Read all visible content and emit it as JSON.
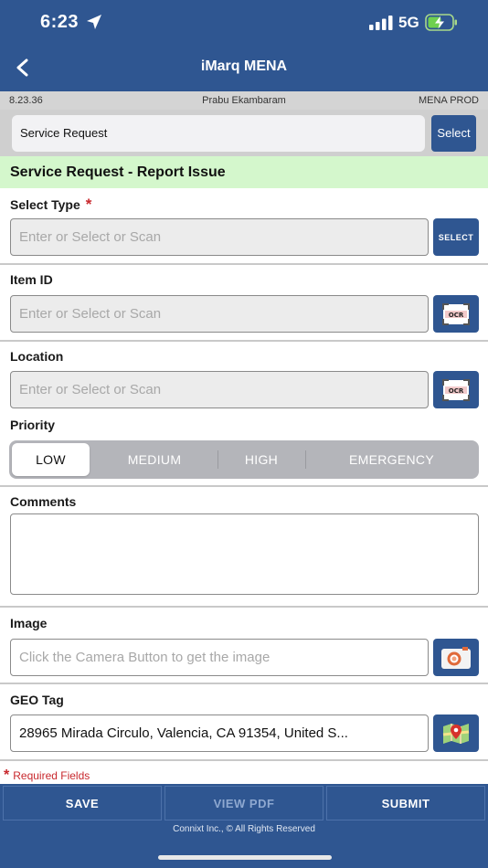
{
  "status": {
    "time": "6:23",
    "network": "5G"
  },
  "header": {
    "title": "iMarq MENA"
  },
  "infobar": {
    "version": "8.23.36",
    "user": "Prabu Ekambaram",
    "environment": "MENA PROD"
  },
  "search": {
    "value": "Service Request",
    "select_label": "Select"
  },
  "section": {
    "title": "Service Request - Report Issue"
  },
  "form": {
    "select_type": {
      "label": "Select Type",
      "required": "*",
      "placeholder": "Enter or Select or Scan",
      "button": "SELECT"
    },
    "item_id": {
      "label": "Item ID",
      "placeholder": "Enter or Select or Scan",
      "button_icon": "ocr-scan-icon"
    },
    "location": {
      "label": "Location",
      "placeholder": "Enter or Select or Scan",
      "button_icon": "ocr-scan-icon"
    },
    "priority": {
      "label": "Priority",
      "options": [
        "LOW",
        "MEDIUM",
        "HIGH",
        "EMERGENCY"
      ],
      "selected": "LOW"
    },
    "comments": {
      "label": "Comments"
    },
    "image": {
      "label": "Image",
      "placeholder": "Click the Camera Button to get the image",
      "button_icon": "camera-icon"
    },
    "geo_tag": {
      "label": "GEO Tag",
      "value": "28965 Mirada Circulo, Valencia, CA  91354, United S...",
      "button_icon": "map-pin-icon"
    }
  },
  "required_note": {
    "star": "*",
    "text": "Required Fields"
  },
  "footer": {
    "save": "SAVE",
    "view_pdf": "VIEW PDF",
    "submit": "SUBMIT",
    "copyright": "Connixt Inc., © All Rights Reserved"
  },
  "colors": {
    "primary": "#2f5691",
    "section_bg": "#d4f7cc",
    "required": "#c8282d",
    "infobar_bg": "#d4d4d4"
  }
}
